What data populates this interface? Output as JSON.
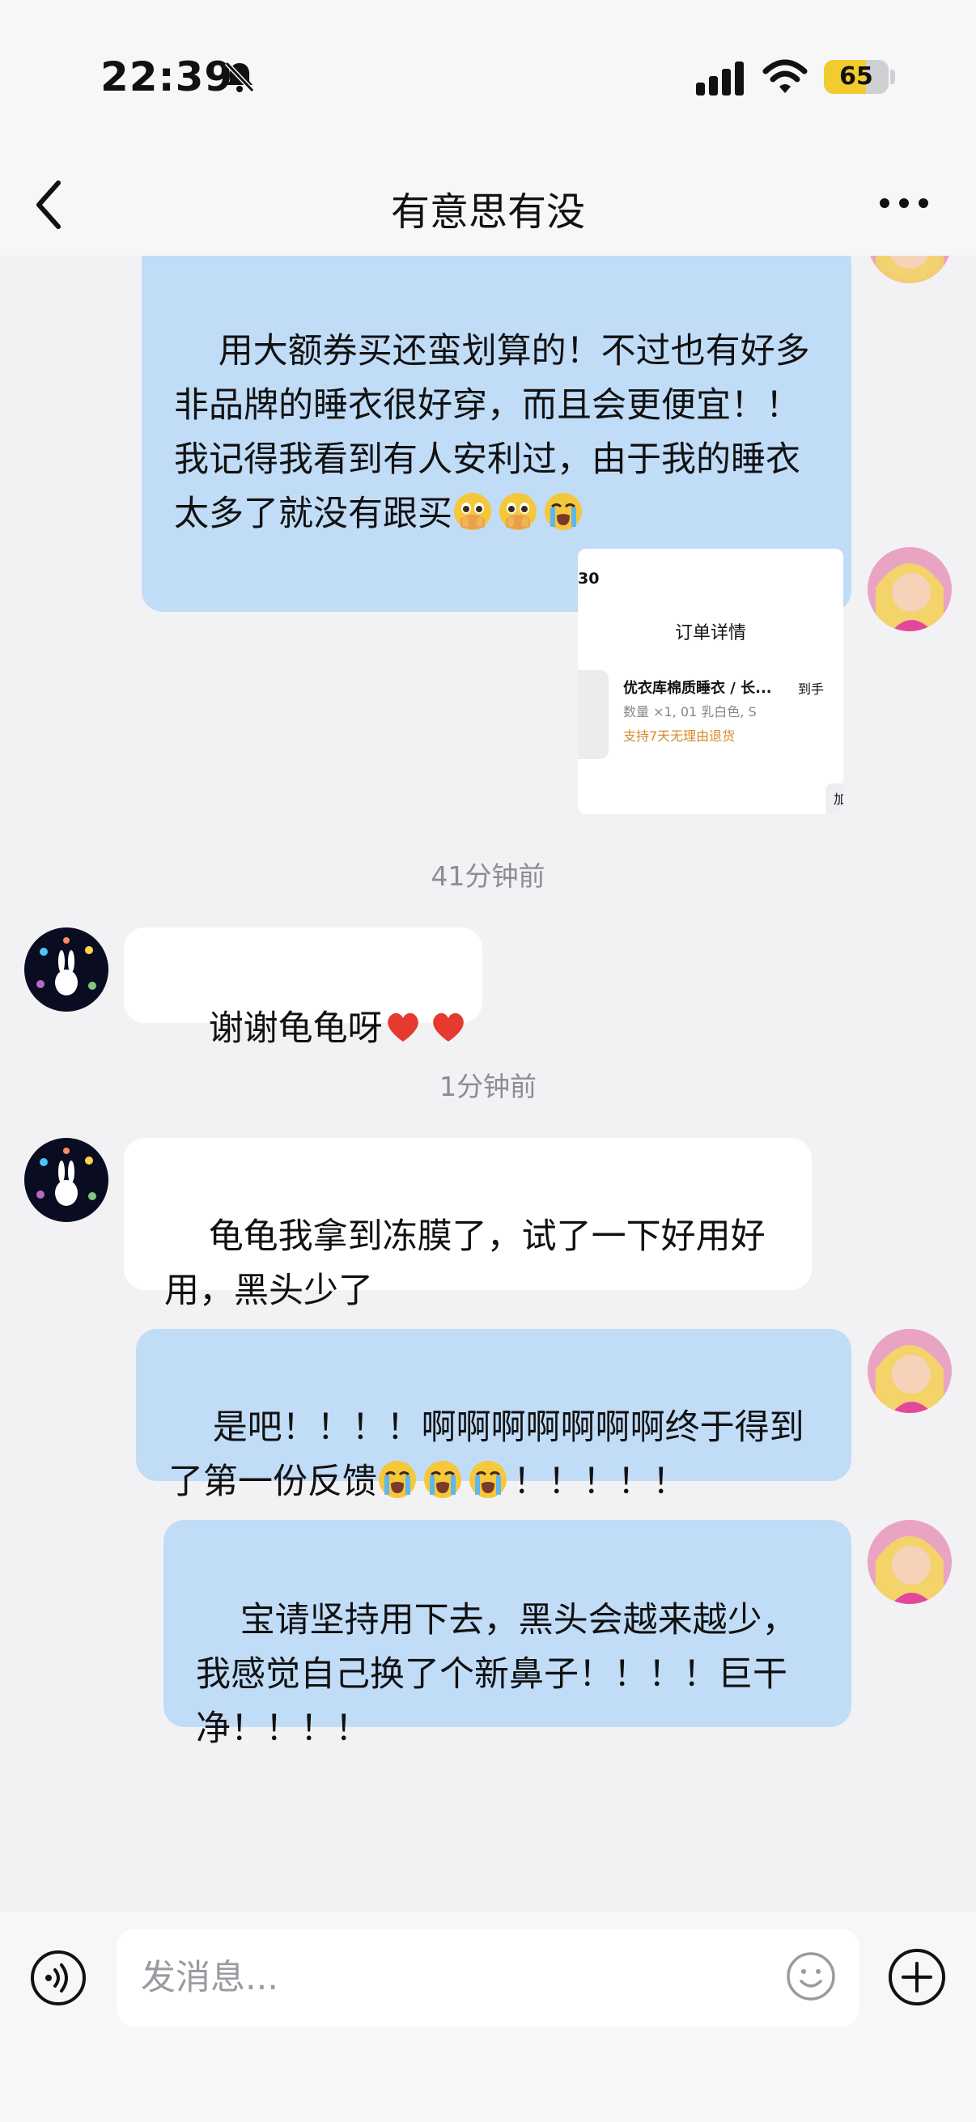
{
  "status_bar": {
    "time": "22:39",
    "battery_level": "65",
    "battery_fraction": 0.65
  },
  "header": {
    "title": "有意思有没"
  },
  "messages": [
    {
      "side": "mine",
      "text": "用大额券买还蛮划算的！不过也有好多非品牌的睡衣很好穿，而且会更便宜！！我记得我看到有人安利过，由于我的睡衣太多了就没有跟买",
      "emojis": [
        "pleading-face-emoji",
        "pleading-face-emoji",
        "loudly-crying-face-emoji"
      ]
    },
    {
      "side": "mine",
      "type": "image",
      "card": {
        "time": "30",
        "title": "订单详情",
        "product": "优衣库棉质睡衣 / 长...",
        "status": "到手",
        "spec": "数量 ×1, 01 乳白色, S",
        "return_policy": "支持7天无理由退货",
        "button": "加"
      }
    },
    {
      "type": "timestamp",
      "text": "41分钟前"
    },
    {
      "side": "theirs",
      "text": "谢谢龟龟呀",
      "emojis": [
        "red-heart-emoji",
        "red-heart-emoji"
      ]
    },
    {
      "type": "timestamp",
      "text": "1分钟前"
    },
    {
      "side": "theirs",
      "text": "龟龟我拿到冻膜了，试了一下好用好用，黑头少了"
    },
    {
      "side": "mine",
      "text": "是吧！！！！啊啊啊啊啊啊啊终于得到了第一份反馈",
      "emojis": [
        "loudly-crying-face-emoji",
        "loudly-crying-face-emoji",
        "loudly-crying-face-emoji"
      ],
      "text_after": "！！！！！"
    },
    {
      "side": "mine",
      "text": "宝请坚持用下去，黑头会越来越少，我感觉自己换了个新鼻子！！！！巨干净！！！！"
    }
  ],
  "input": {
    "placeholder": "发消息..."
  },
  "colors": {
    "my_bubble": "#c1dcf7",
    "their_bubble": "#ffffff",
    "background": "#f2f2f4",
    "battery": "#f2cc2f"
  },
  "icons": {
    "back": "chevron-left-icon",
    "more": "more-dots-icon",
    "voice": "voice-icon",
    "emoji": "smile-icon",
    "plus": "plus-icon",
    "mute": "bell-slash-icon",
    "signal": "signal-icon",
    "wifi": "wifi-icon"
  }
}
